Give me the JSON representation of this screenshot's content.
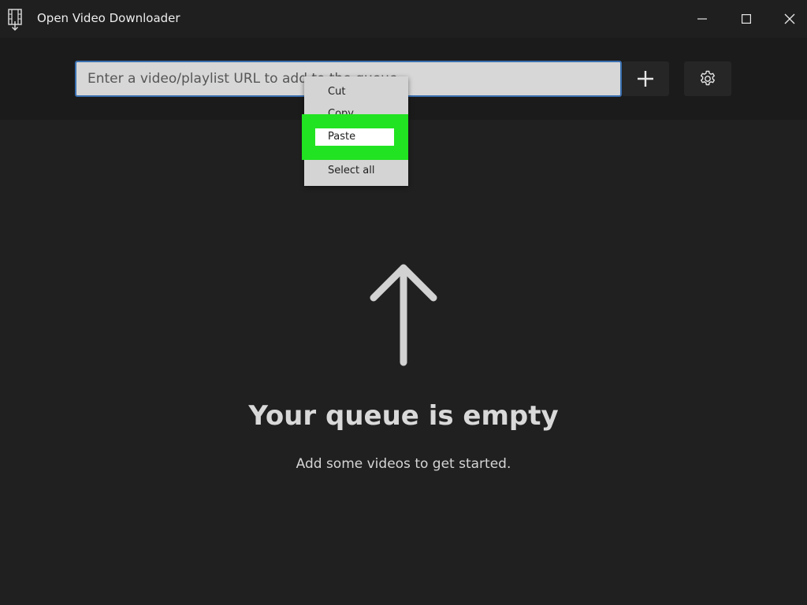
{
  "window": {
    "title": "Open Video Downloader"
  },
  "toolbar": {
    "url_placeholder": "Enter a video/playlist URL to add to the queue",
    "add_icon": "plus-icon",
    "settings_icon": "gear-icon"
  },
  "context_menu": {
    "items": [
      {
        "label": "Cut"
      },
      {
        "label": "Copy"
      },
      {
        "label": "Paste",
        "highlighted": true
      },
      {
        "label": "Select all"
      }
    ],
    "highlight_color": "#22e322"
  },
  "empty_state": {
    "icon": "arrow-up-icon",
    "title": "Your queue is empty",
    "subtitle": "Add some videos to get started."
  },
  "colors": {
    "background": "#202020",
    "toolbar": "#1b1b1b",
    "input_border": "#3a6fb0"
  }
}
